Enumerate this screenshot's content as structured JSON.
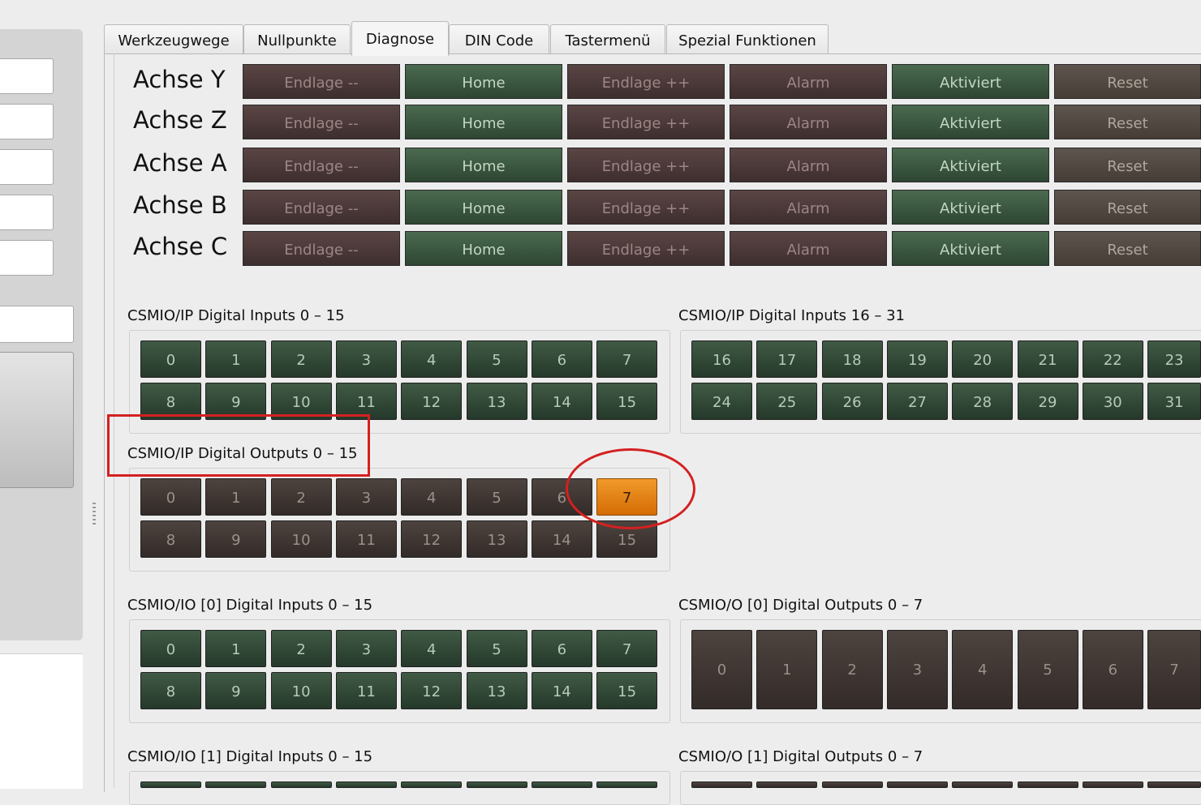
{
  "tabs": [
    "Werkzeugwege",
    "Nullpunkte",
    "Diagnose",
    "DIN Code",
    "Tastermenü",
    "Spezial Funktionen"
  ],
  "active_tab": "Diagnose",
  "axes": [
    {
      "label": "Achse Y"
    },
    {
      "label": "Achse Z"
    },
    {
      "label": "Achse A"
    },
    {
      "label": "Achse B"
    },
    {
      "label": "Achse C"
    }
  ],
  "axis_buttons": [
    "Endlage --",
    "Home",
    "Endlage ++",
    "Alarm",
    "Aktiviert",
    "Reset"
  ],
  "groups": {
    "ip_inputs_0_15": {
      "title": "CSMIO/IP Digital Inputs 0 – 15",
      "labels": [
        "0",
        "1",
        "2",
        "3",
        "4",
        "5",
        "6",
        "7",
        "8",
        "9",
        "10",
        "11",
        "12",
        "13",
        "14",
        "15"
      ]
    },
    "ip_inputs_16_31": {
      "title": "CSMIO/IP Digital Inputs 16 – 31",
      "labels": [
        "16",
        "17",
        "18",
        "19",
        "20",
        "21",
        "22",
        "23",
        "24",
        "25",
        "26",
        "27",
        "28",
        "29",
        "30",
        "31"
      ]
    },
    "ip_outputs_0_15": {
      "title": "CSMIO/IP Digital Outputs 0 – 15",
      "labels": [
        "0",
        "1",
        "2",
        "3",
        "4",
        "5",
        "6",
        "7",
        "8",
        "9",
        "10",
        "11",
        "12",
        "13",
        "14",
        "15"
      ],
      "active": [
        "7"
      ]
    },
    "io0_inputs": {
      "title": "CSMIO/IO [0] Digital Inputs 0 – 15",
      "labels": [
        "0",
        "1",
        "2",
        "3",
        "4",
        "5",
        "6",
        "7",
        "8",
        "9",
        "10",
        "11",
        "12",
        "13",
        "14",
        "15"
      ]
    },
    "o0_outputs": {
      "title": "CSMIO/O [0] Digital Outputs 0 – 7",
      "labels": [
        "0",
        "1",
        "2",
        "3",
        "4",
        "5",
        "6",
        "7"
      ]
    },
    "io1_inputs": {
      "title": "CSMIO/IO [1] Digital Inputs 0 – 15"
    },
    "o1_outputs": {
      "title": "CSMIO/O [1] Digital Outputs 0 – 7"
    }
  },
  "colors": {
    "active_output": "#f08a14",
    "annotation": "#d42020"
  }
}
